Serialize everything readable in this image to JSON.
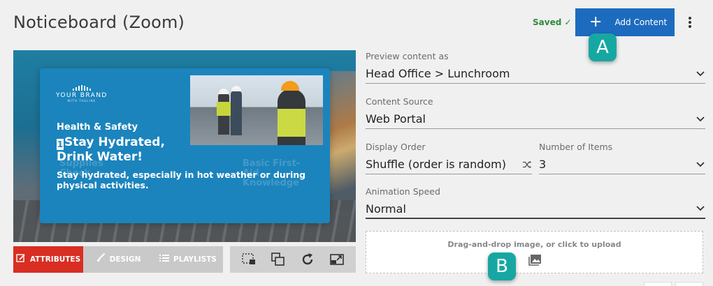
{
  "header": {
    "title": "Noticeboard (Zoom)",
    "saved_label": "Saved",
    "saved_check": "✓",
    "add_content_label": "Add Content",
    "add_content_icon": "plus-icon",
    "more_icon": "kebab-menu-icon"
  },
  "markers": {
    "a": "A",
    "b": "B"
  },
  "preview": {
    "brand_name": "YOUR BRAND",
    "brand_tag": "WITH TAGLINE",
    "heading": "Health & Safety",
    "title_number": "1",
    "title": "Stay Hydrated, Drink Water!",
    "body": "Stay hydrated, especially in hot weather or during physical activities.",
    "ghost_left": "Supplies Check",
    "ghost_right": "Basic First-Aid Knowledge"
  },
  "toolbar": {
    "tabs": [
      {
        "label": "ATTRIBUTES",
        "icon": "edit-icon",
        "active": true
      },
      {
        "label": "DESIGN",
        "icon": "brush-icon",
        "active": false
      },
      {
        "label": "PLAYLISTS",
        "icon": "list-icon",
        "active": false
      }
    ],
    "tools": [
      "screenshot-icon",
      "duplicate-icon",
      "refresh-icon",
      "external-window-icon"
    ]
  },
  "form": {
    "preview_as": {
      "label": "Preview content as",
      "value": "Head Office > Lunchroom"
    },
    "content_source": {
      "label": "Content Source",
      "value": "Web Portal"
    },
    "display_order": {
      "label": "Display Order",
      "value": "Shuffle (order is random)",
      "icon": "shuffle-icon"
    },
    "number_of_items": {
      "label": "Number of Items",
      "value": "3"
    },
    "animation_speed": {
      "label": "Animation Speed",
      "value": "Normal"
    }
  },
  "upload": {
    "text": "Drag-and-drop image, or click to upload",
    "icon": "image-icon"
  },
  "colors": {
    "primary": "#1d6bbf",
    "accent_red": "#d92e22",
    "marker": "#17a7a3",
    "saved": "#2e8b3a"
  }
}
